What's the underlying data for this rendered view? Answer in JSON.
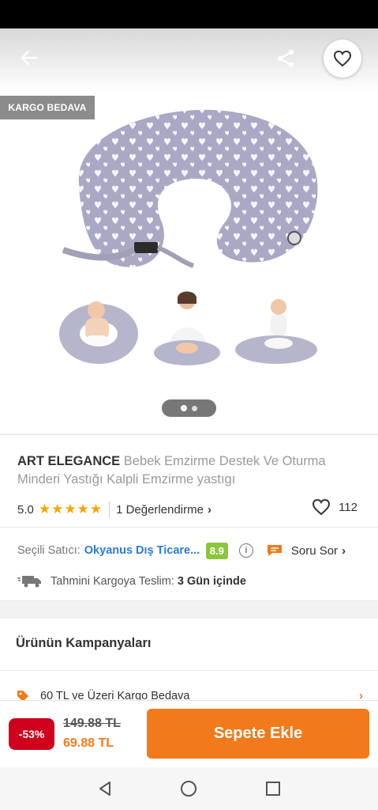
{
  "badge": {
    "label": "KARGO BEDAVA"
  },
  "gallery": {
    "pages": 2,
    "active_page": 1
  },
  "product": {
    "brand": "ART ELEGANCE",
    "name": "Bebek Emzirme Destek Ve Oturma Minderi Yastığı Kalpli Emzirme yastıgı",
    "rating": "5.0",
    "stars": "★★★★★",
    "reviews_label": "1 Değerlendirme",
    "likes": "112"
  },
  "seller": {
    "label": "Seçili Satıcı:",
    "name": "Okyanus Dış Ticare...",
    "score": "8.9",
    "ask_label": "Soru Sor"
  },
  "shipping": {
    "label": "Tahmini Kargoya Teslim:",
    "days": "3 Gün içinde"
  },
  "campaigns": {
    "title": "Ürünün Kampanyaları",
    "item": "60 TL ve Üzeri Kargo Bedava"
  },
  "cart": {
    "discount": "-53%",
    "old_price": "149.88 TL",
    "new_price": "69.88 TL",
    "button_label": "Sepete Ekle"
  },
  "colors": {
    "accent": "#f27a1a",
    "seller_link": "#2a7bd8",
    "seller_score": "#8cc63f",
    "discount": "#d0001d",
    "star": "#f7a500"
  }
}
